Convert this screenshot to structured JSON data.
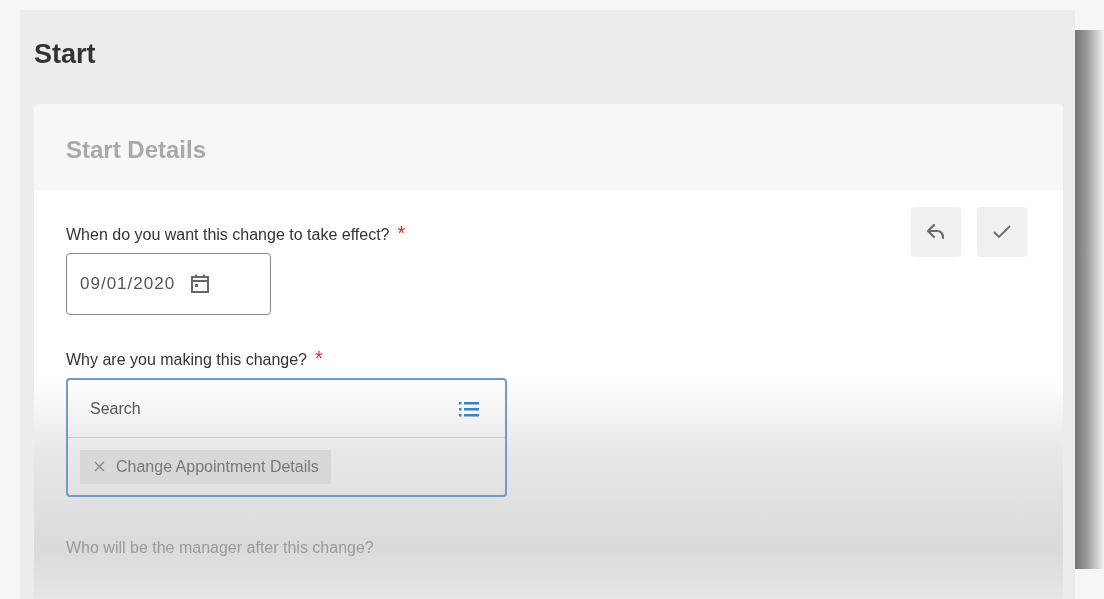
{
  "page": {
    "title": "Start"
  },
  "section": {
    "title": "Start Details"
  },
  "actions": [
    {
      "kind": "undo"
    },
    {
      "kind": "confirm"
    }
  ],
  "fields": [
    {
      "kind": "date",
      "label": "When do you want this change to take effect?",
      "required_mark": "*",
      "value": "09/01/2020"
    },
    {
      "kind": "prompt",
      "label": "Why are you making this change?",
      "required_mark": "*",
      "focused": true,
      "placeholder": "Search",
      "selections": [
        "Change Appointment Details"
      ]
    },
    {
      "kind": "faded",
      "label": "Who will be the manager after this change?"
    }
  ]
}
